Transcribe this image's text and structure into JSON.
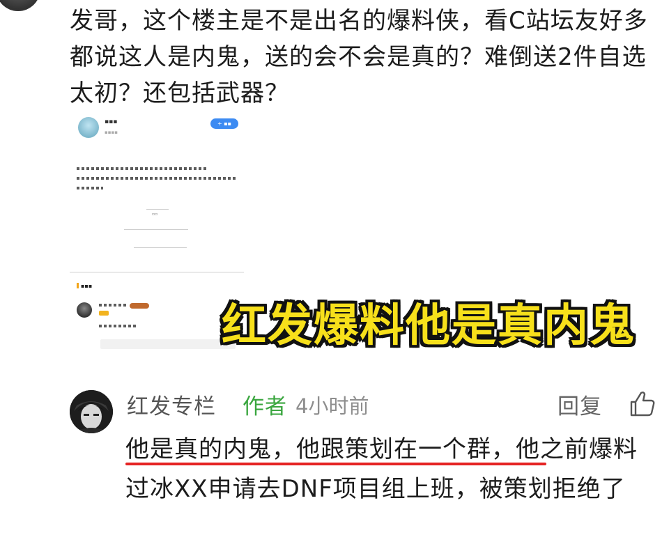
{
  "post": {
    "text": "发哥，这个楼主是不是出名的爆料侠，看C站坛友好多都说这人是内鬼，送的会不会是真的？难倒送2件自选太初？还包括武器？"
  },
  "caption": {
    "text": "红发爆料他是真内鬼"
  },
  "comment": {
    "author": "红发专栏",
    "author_tag": "作者",
    "time": "4小时前",
    "reply_label": "回复",
    "like_icon": "thumbs-up-icon",
    "body": "他是真的内鬼，他跟策划在一个群，他之前爆料过冰XX申请去DNF项目组上班，被策划拒绝了"
  },
  "colors": {
    "author_tag": "#3aa63f",
    "caption_fill": "#f7e01b",
    "caption_outline": "#111111",
    "underline": "#e52323"
  }
}
